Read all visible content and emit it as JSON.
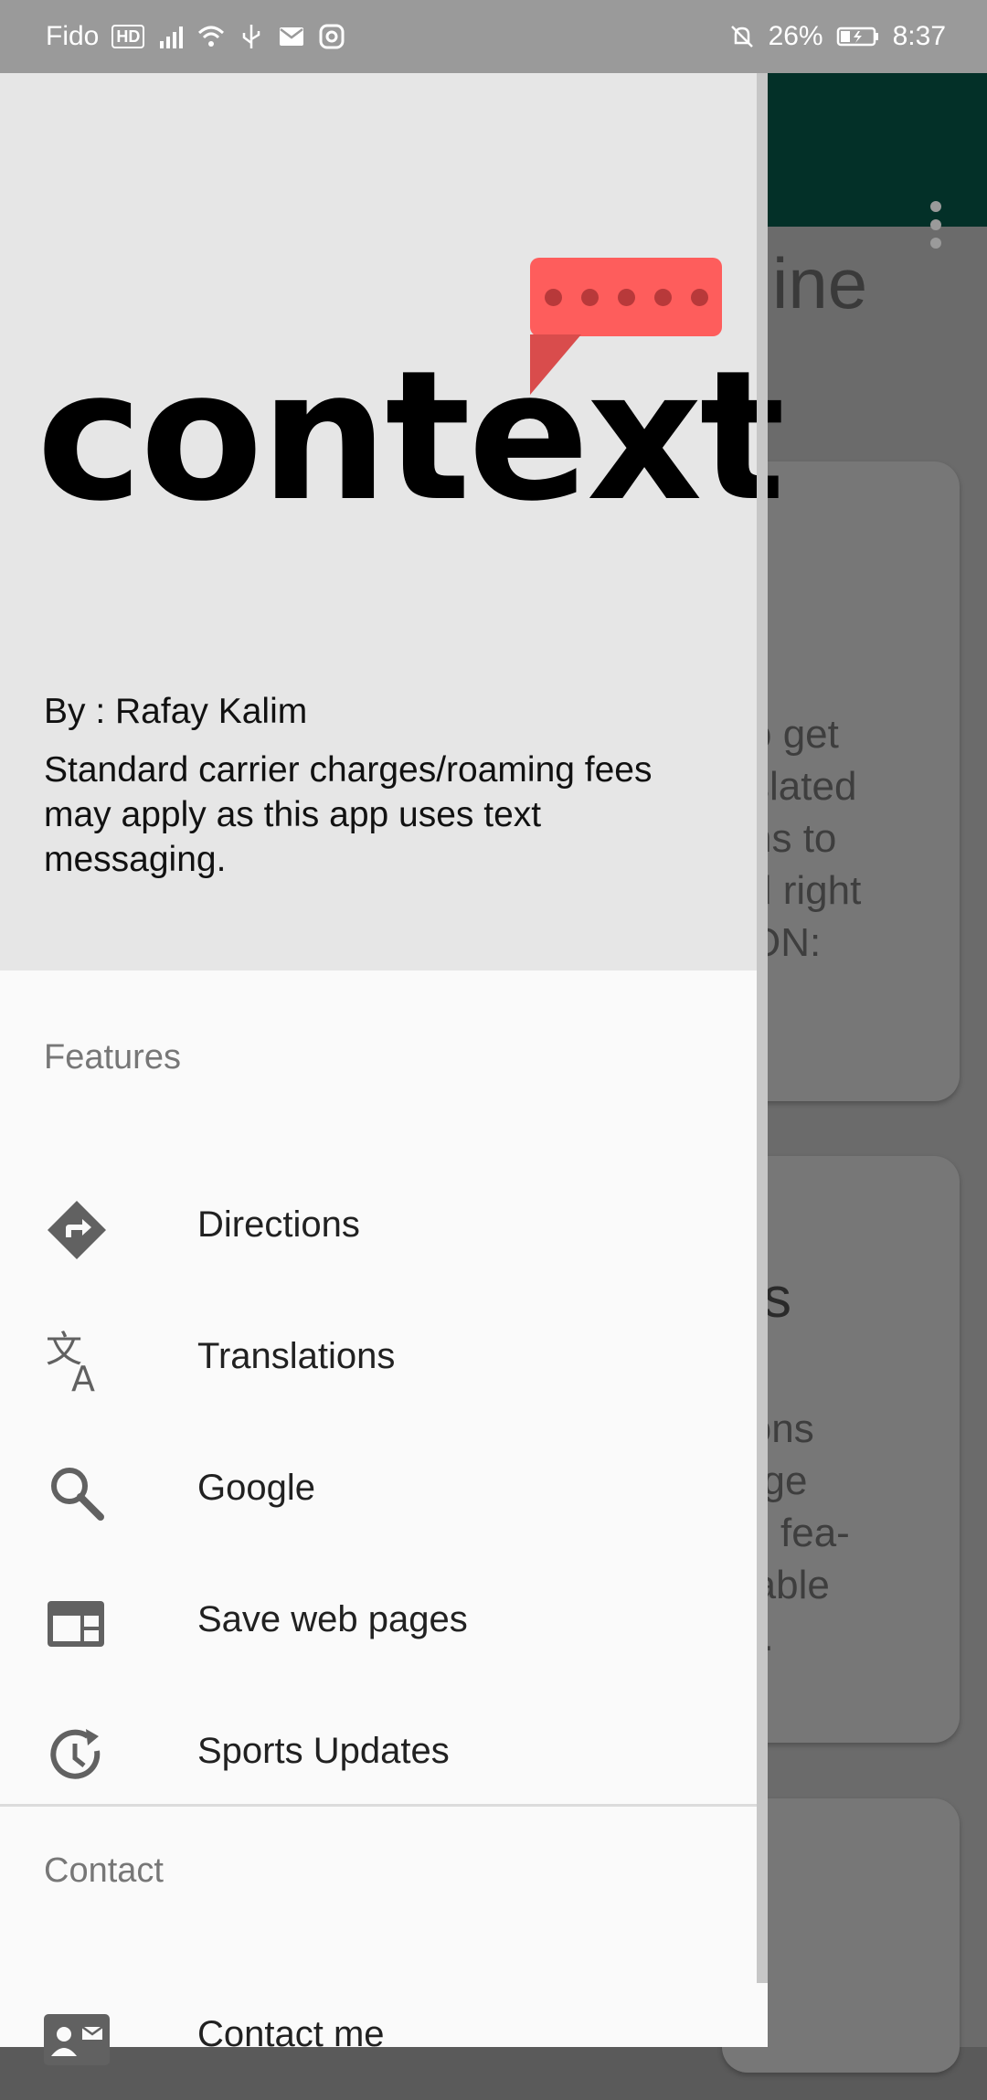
{
  "status_bar": {
    "carrier": "Fido",
    "hd_badge": "HD",
    "battery_percent": "26%",
    "time": "8:37"
  },
  "drawer": {
    "header": {
      "logo_text": "context",
      "byline": "By : Rafay Kalim",
      "disclaimer": "Standard carrier charges/roaming fees may apply as this app uses text messaging."
    },
    "features_label": "Features",
    "features": [
      {
        "label": "Directions",
        "icon": "directions-icon"
      },
      {
        "label": "Translations",
        "icon": "translate-icon"
      },
      {
        "label": "Google",
        "icon": "search-icon"
      },
      {
        "label": "Save web pages",
        "icon": "web-page-icon"
      },
      {
        "label": "Sports Updates",
        "icon": "update-clock-icon"
      }
    ],
    "contact_label": "Contact",
    "contact": [
      {
        "label": "Contact me",
        "icon": "contact-card-icon"
      }
    ]
  },
  "background": {
    "title_fragment": "ine",
    "card1_text": "o get\nslated\nns to\nd right\nON:",
    "card2_heading": "s",
    "card2_text": "ions\nage\nR fea-\nrable\nd."
  },
  "colors": {
    "toolbar": "#033028",
    "logo_bubble": "#fe5d5c",
    "header_bg": "#e6e6e6"
  }
}
